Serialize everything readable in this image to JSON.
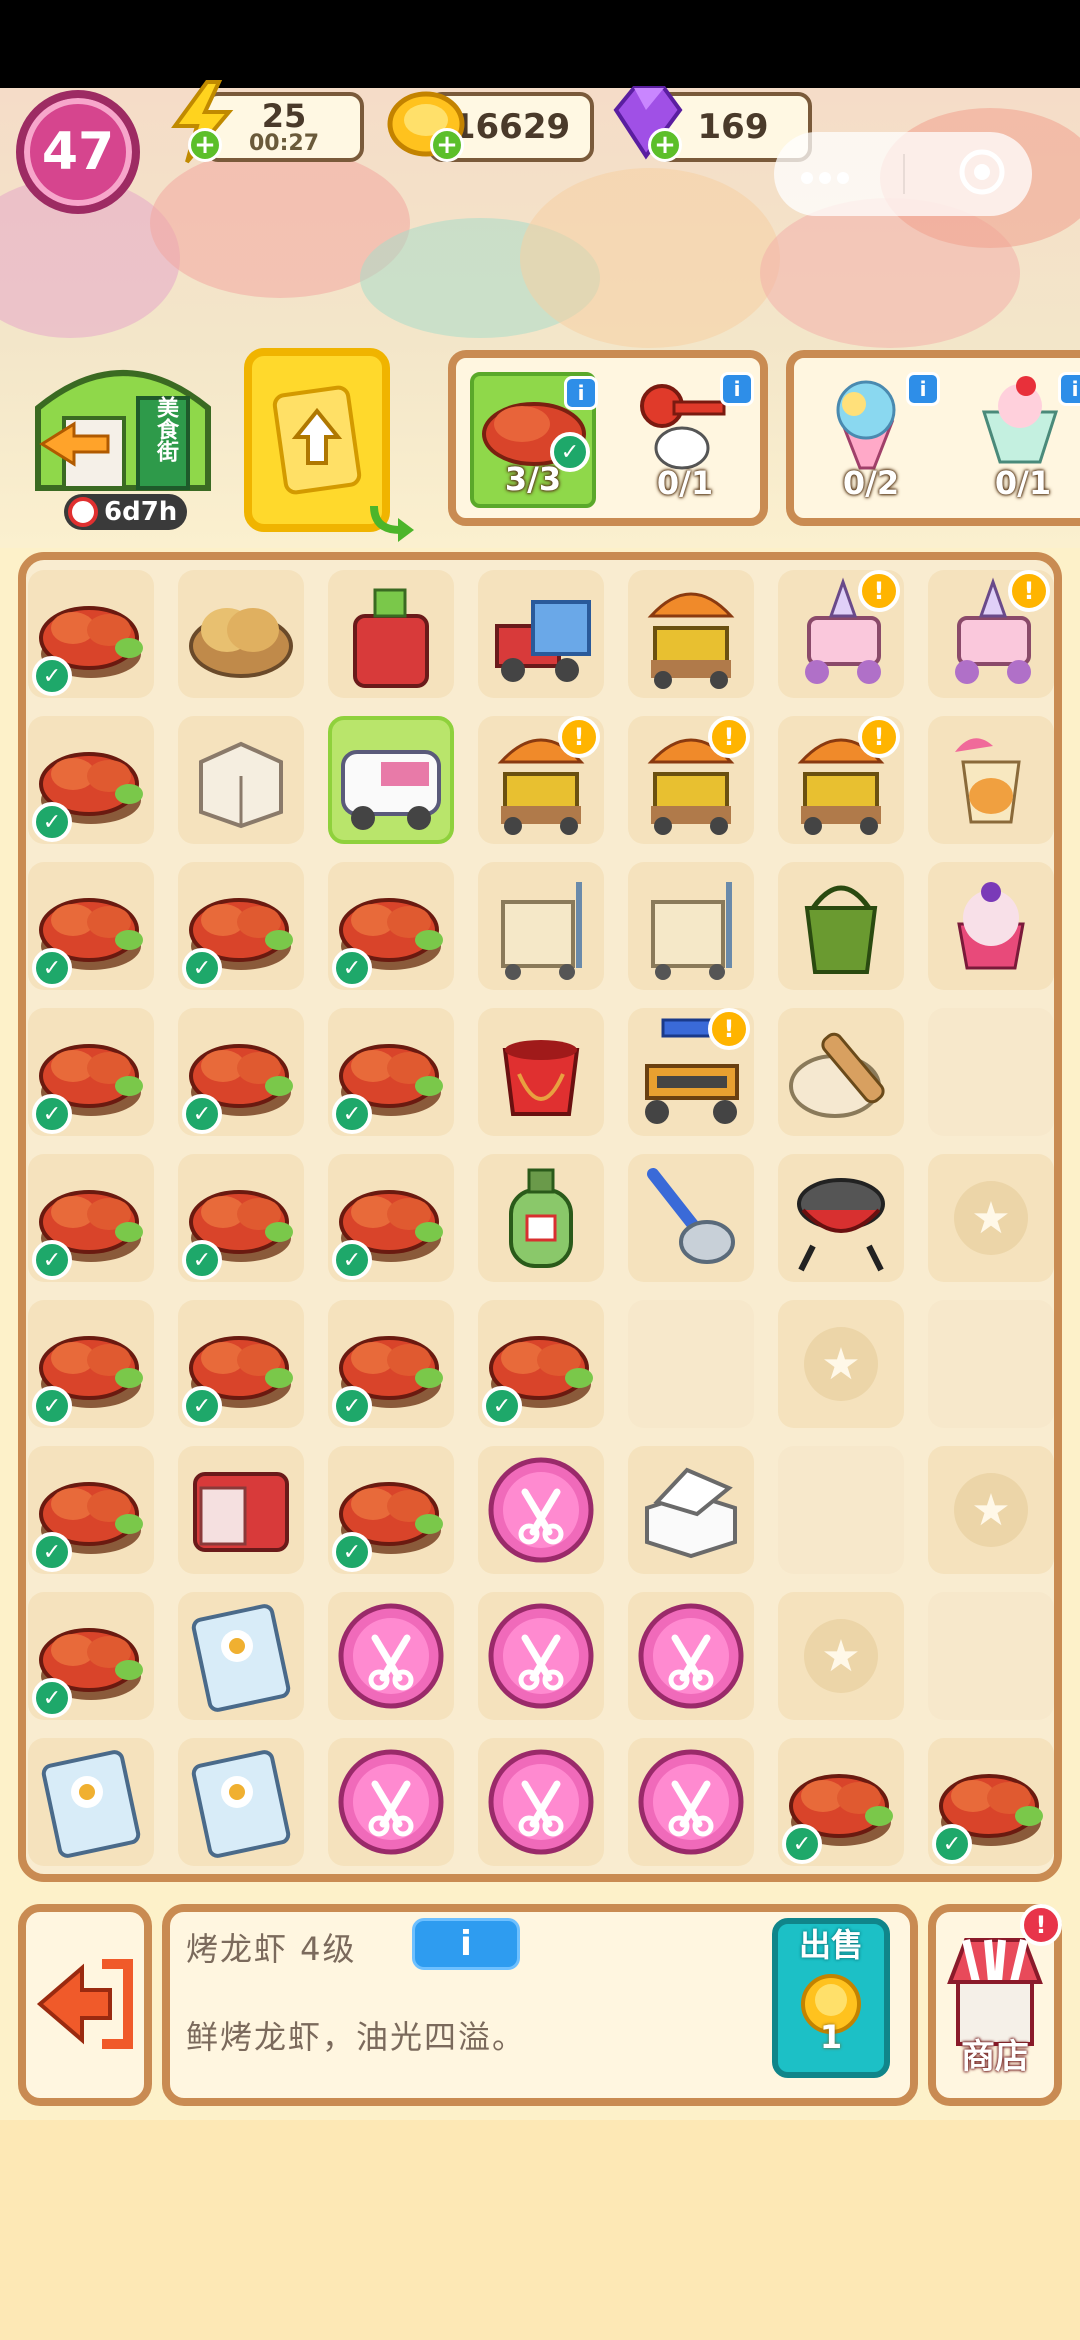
{
  "hud": {
    "level": "47",
    "energy": "25",
    "energy_timer": "00:27",
    "coins": "16629",
    "gems": "169",
    "plus_symbol": "+"
  },
  "district": {
    "sign": "美食街",
    "timer": "6d7h"
  },
  "orders": [
    {
      "item": "grilled-crayfish",
      "count": "3/3",
      "complete": true
    },
    {
      "item": "red-key",
      "count": "0/1",
      "complete": false
    },
    {
      "item": "rainbow-ice-cream",
      "count": "0/2",
      "complete": false
    },
    {
      "item": "strawberry-sundae",
      "count": "0/1",
      "complete": false
    }
  ],
  "board": {
    "rows": [
      [
        {
          "i": "crayfish",
          "c": true
        },
        {
          "i": "pancakes"
        },
        {
          "i": "red-cabinet-cactus"
        },
        {
          "i": "toy-truck"
        },
        {
          "i": "bbq-cart-umbrella"
        },
        {
          "i": "ice-cream-cart",
          "e": true
        },
        {
          "i": "ice-cream-cart",
          "e": true
        }
      ],
      [
        {
          "i": "crayfish",
          "c": true
        },
        {
          "i": "cardboard-box"
        },
        {
          "i": "food-truck",
          "sel": true
        },
        {
          "i": "bbq-cart-umbrella",
          "e": true
        },
        {
          "i": "bbq-cart-umbrella",
          "e": true
        },
        {
          "i": "bbq-cart-umbrella",
          "e": true
        },
        {
          "i": "cocktail-drink"
        }
      ],
      [
        {
          "i": "crayfish",
          "c": true
        },
        {
          "i": "crayfish",
          "c": true
        },
        {
          "i": "crayfish",
          "c": true
        },
        {
          "i": "hand-truck-boxes"
        },
        {
          "i": "hand-truck-boxes"
        },
        {
          "i": "green-bucket"
        },
        {
          "i": "ice-cream-cup"
        }
      ],
      [
        {
          "i": "crayfish",
          "c": true
        },
        {
          "i": "crayfish",
          "c": true
        },
        {
          "i": "crayfish",
          "c": true
        },
        {
          "i": "red-bucket"
        },
        {
          "i": "grill-stall",
          "e": true
        },
        {
          "i": "dough-rolling-pin"
        },
        {
          "i": "empty"
        }
      ],
      [
        {
          "i": "crayfish",
          "c": true
        },
        {
          "i": "crayfish",
          "c": true
        },
        {
          "i": "crayfish",
          "c": true
        },
        {
          "i": "gas-cylinder"
        },
        {
          "i": "ladle"
        },
        {
          "i": "bbq-grill"
        },
        {
          "i": "locked"
        }
      ],
      [
        {
          "i": "crayfish",
          "c": true
        },
        {
          "i": "crayfish",
          "c": true
        },
        {
          "i": "crayfish",
          "c": true
        },
        {
          "i": "crayfish",
          "c": true
        },
        {
          "i": "empty"
        },
        {
          "i": "locked"
        },
        {
          "i": "empty"
        }
      ],
      [
        {
          "i": "crayfish",
          "c": true
        },
        {
          "i": "mini-fridge"
        },
        {
          "i": "crayfish",
          "c": true
        },
        {
          "i": "scissors-token"
        },
        {
          "i": "takeout-box"
        },
        {
          "i": "empty"
        },
        {
          "i": "locked"
        }
      ],
      [
        {
          "i": "crayfish",
          "c": true
        },
        {
          "i": "noodle-pack"
        },
        {
          "i": "scissors-token"
        },
        {
          "i": "scissors-token"
        },
        {
          "i": "scissors-token"
        },
        {
          "i": "locked"
        },
        {
          "i": "empty"
        }
      ],
      [
        {
          "i": "noodle-pack"
        },
        {
          "i": "noodle-pack"
        },
        {
          "i": "scissors-token"
        },
        {
          "i": "scissors-token"
        },
        {
          "i": "scissors-token"
        },
        {
          "i": "crayfish",
          "c": true
        },
        {
          "i": "crayfish",
          "c": true
        }
      ]
    ]
  },
  "selected_item": {
    "name_level": "烤龙虾  4级",
    "description": "鲜烤龙虾，油光四溢。",
    "info_label": "i"
  },
  "actions": {
    "sell_label": "出售",
    "sell_value": "1",
    "shop_label": "商店"
  },
  "colors": {
    "board_bg": "#f9ecd0",
    "board_border": "#c98b52",
    "check_green": "#1ea86a",
    "level_pink": "#d6458e",
    "sell_teal": "#1cc0c6"
  }
}
